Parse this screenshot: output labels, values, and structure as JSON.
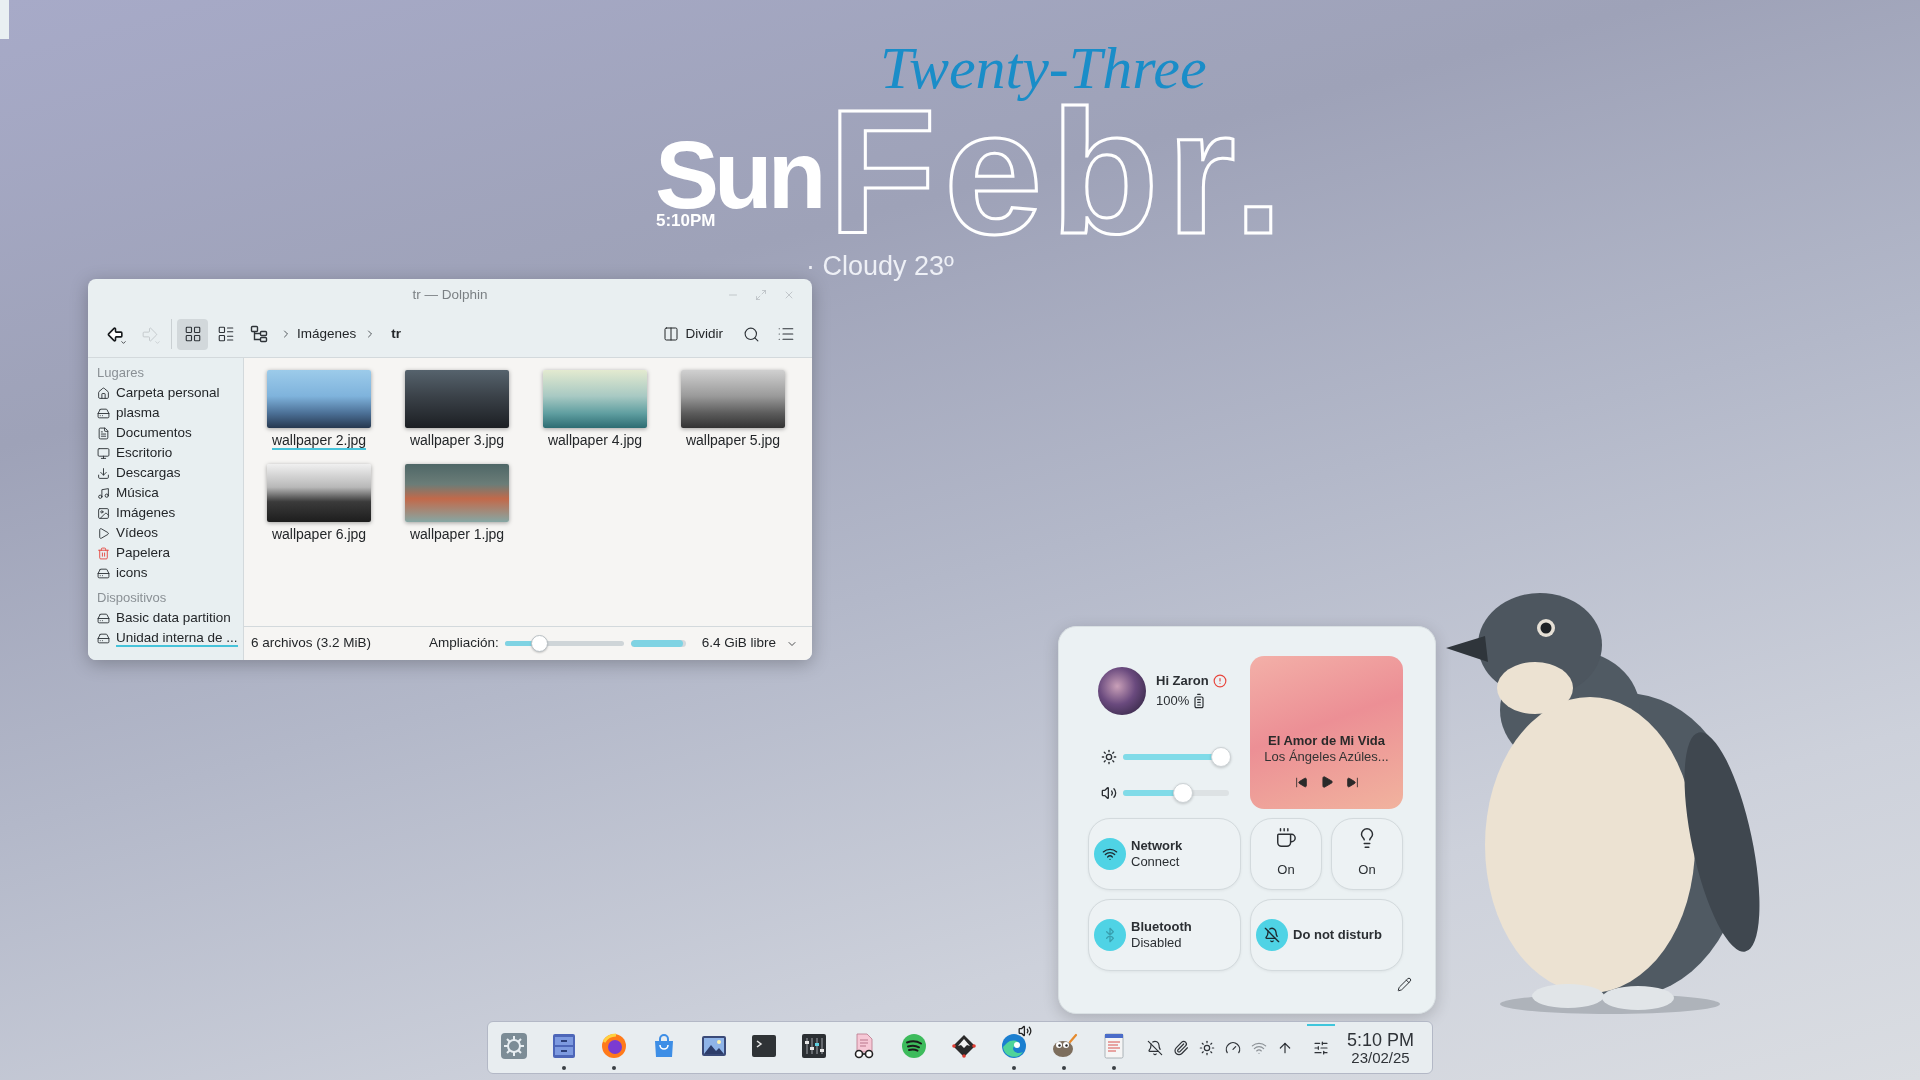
{
  "clock_widget": {
    "day": "Sun",
    "time": "5:10PM",
    "month": "Febr.",
    "day_words": "Twenty-Three",
    "weather": "· Cloudy 23º"
  },
  "file_manager": {
    "title": "tr — Dolphin",
    "nav": [
      {
        "kind": "back",
        "disabled": false
      },
      {
        "kind": "forward",
        "disabled": true
      }
    ],
    "view_modes": [
      {
        "kind": "icons",
        "selected": true
      },
      {
        "kind": "compact",
        "selected": false
      },
      {
        "kind": "tree",
        "selected": false
      }
    ],
    "breadcrumb": [
      "Imágenes",
      "tr"
    ],
    "split_label": "Dividir",
    "sidebar": [
      {
        "heading": "Lugares",
        "items": [
          {
            "kind": "home",
            "label": "Carpeta personal",
            "selected": false
          },
          {
            "kind": "drive",
            "label": "plasma",
            "selected": false
          },
          {
            "kind": "document",
            "label": "Documentos",
            "selected": false
          },
          {
            "kind": "desktop",
            "label": "Escritorio",
            "selected": false
          },
          {
            "kind": "download",
            "label": "Descargas",
            "selected": false
          },
          {
            "kind": "music",
            "label": "Música",
            "selected": false
          },
          {
            "kind": "pictures",
            "label": "Imágenes",
            "selected": false
          },
          {
            "kind": "videos",
            "label": "Vídeos",
            "selected": false
          },
          {
            "kind": "trash",
            "label": "Papelera",
            "selected": false
          },
          {
            "kind": "drive",
            "label": "icons",
            "selected": false
          }
        ]
      },
      {
        "heading": "Dispositivos",
        "items": [
          {
            "kind": "disk",
            "label": "Basic data partition",
            "selected": false
          },
          {
            "kind": "disk",
            "label": "Unidad interna de ...",
            "selected": true
          }
        ]
      }
    ],
    "files": [
      {
        "name": "wallpaper 2.jpg",
        "selected": true
      },
      {
        "name": "wallpaper 3.jpg",
        "selected": false
      },
      {
        "name": "wallpaper 4.jpg",
        "selected": false
      },
      {
        "name": "wallpaper 5.jpg",
        "selected": false
      },
      {
        "name": "wallpaper 6.jpg",
        "selected": false
      },
      {
        "name": "wallpaper 1.jpg",
        "selected": false
      }
    ],
    "status_bar": {
      "summary": "6 archivos (3.2 MiB)",
      "zoom": {
        "label": "Ampliación:",
        "level": 0.29
      },
      "disk": {
        "level": 0.95,
        "free": "6.4 GiB libre"
      }
    }
  },
  "control_center": {
    "user": {
      "greeting": "Hi Zaron",
      "battery": "100%"
    },
    "sliders": [
      {
        "kind": "brightness",
        "level": 0.92
      },
      {
        "kind": "volume",
        "level": 0.57
      }
    ],
    "media": {
      "title": "El Amor de Mi Vida",
      "artist": "Los Ángeles Azúles..."
    },
    "tiles": [
      {
        "kind": "network",
        "title": "Network",
        "subtitle": "Connect"
      },
      {
        "kind": "caffeine",
        "title": "On"
      },
      {
        "kind": "light",
        "title": "On"
      },
      {
        "kind": "bluetooth",
        "title": "Bluetooth",
        "subtitle": "Disabled"
      },
      {
        "kind": "dnd",
        "title": "Do not disturb"
      }
    ]
  },
  "taskbar": {
    "apps": [
      {
        "kind": "launcher",
        "running": false,
        "audio": false
      },
      {
        "kind": "files",
        "running": true,
        "audio": false
      },
      {
        "kind": "browser",
        "running": true,
        "audio": false
      },
      {
        "kind": "store",
        "running": false,
        "audio": false
      },
      {
        "kind": "images",
        "running": false,
        "audio": false
      },
      {
        "kind": "terminal",
        "running": false,
        "audio": false
      },
      {
        "kind": "mixer",
        "running": false,
        "audio": false
      },
      {
        "kind": "reader",
        "running": false,
        "audio": false
      },
      {
        "kind": "music",
        "running": false,
        "audio": false
      },
      {
        "kind": "vector",
        "running": false,
        "audio": false
      },
      {
        "kind": "web",
        "running": true,
        "audio": true
      },
      {
        "kind": "paint",
        "running": true,
        "audio": false
      },
      {
        "kind": "notes",
        "running": true,
        "audio": false
      }
    ],
    "tray": [
      {
        "kind": "notifications-off",
        "active": false
      },
      {
        "kind": "attachments",
        "active": false
      },
      {
        "kind": "brightness",
        "active": false
      },
      {
        "kind": "performance",
        "active": false
      },
      {
        "kind": "network",
        "active": false
      },
      {
        "kind": "updates",
        "active": false
      },
      {
        "kind": "quick-settings",
        "active": true
      }
    ],
    "clock": {
      "time": "5:10 PM",
      "date": "23/02/25"
    }
  }
}
